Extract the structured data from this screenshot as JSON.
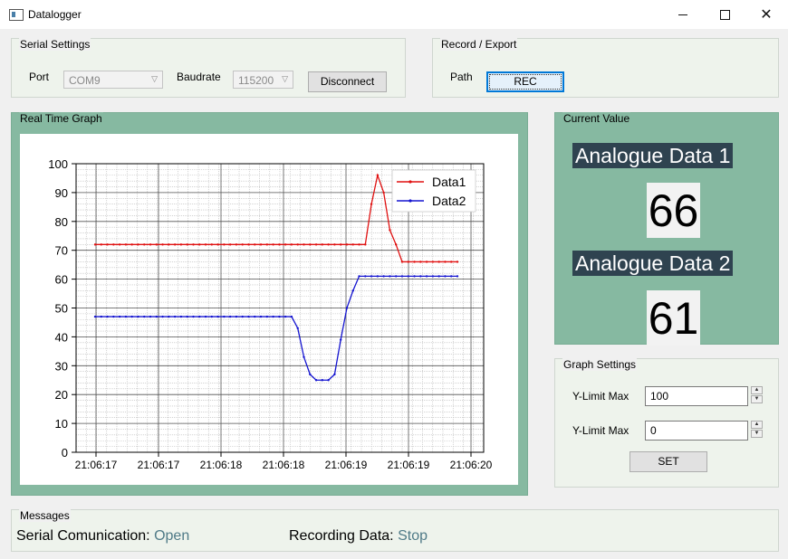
{
  "window": {
    "title": "Datalogger",
    "minimize_icon": "minimize-icon",
    "maximize_icon": "maximize-icon",
    "close_icon": "close-icon",
    "close_glyph": "✕"
  },
  "serial": {
    "group_label": "Serial Settings",
    "port_label": "Port",
    "port_value": "COM9",
    "baud_label": "Baudrate",
    "baud_value": "115200",
    "disconnect_label": "Disconnect",
    "chevron": "▽"
  },
  "record": {
    "group_label": "Record / Export",
    "path_label": "Path",
    "rec_label": "REC"
  },
  "graph": {
    "group_label": "Real Time Graph"
  },
  "current": {
    "group_label": "Current Value",
    "label1": "Analogue Data 1",
    "value1": "66",
    "label2": "Analogue Data 2",
    "value2": "61"
  },
  "graph_settings": {
    "group_label": "Graph Settings",
    "ymax_label": "Y-Limit Max",
    "ymax_value": "100",
    "ymin_label": "Y-Limit Max",
    "ymin_value": "0",
    "set_label": "SET",
    "up_glyph": "▲",
    "down_glyph": "▼"
  },
  "messages": {
    "group_label": "Messages",
    "serial_label": "Serial Comunication:",
    "serial_value": "Open",
    "recording_label": "Recording Data:",
    "recording_value": "Stop"
  },
  "chart_data": {
    "type": "line",
    "x": [
      0,
      1,
      2,
      3,
      4,
      5,
      6,
      7,
      8,
      9,
      10,
      11,
      12,
      13,
      14,
      15,
      16,
      17,
      18,
      19,
      20,
      21,
      22,
      23,
      24,
      25,
      26,
      27,
      28,
      29,
      30,
      31,
      32,
      33,
      34,
      35,
      36,
      37,
      38,
      39,
      40,
      41,
      42,
      43,
      44,
      45,
      46,
      47,
      48,
      49,
      50,
      51,
      52,
      53,
      54,
      55,
      56,
      57,
      58,
      59
    ],
    "xticklabels": [
      "21:06:17",
      "21:06:17",
      "21:06:18",
      "21:06:18",
      "21:06:19",
      "21:06:19",
      "21:06:20"
    ],
    "ylim": [
      0,
      100
    ],
    "yticks": [
      0,
      10,
      20,
      30,
      40,
      50,
      60,
      70,
      80,
      90,
      100
    ],
    "grid": true,
    "legend": "top-right",
    "series": [
      {
        "name": "Data1",
        "color": "#e01010",
        "values": [
          72,
          72,
          72,
          72,
          72,
          72,
          72,
          72,
          72,
          72,
          72,
          72,
          72,
          72,
          72,
          72,
          72,
          72,
          72,
          72,
          72,
          72,
          72,
          72,
          72,
          72,
          72,
          72,
          72,
          72,
          72,
          72,
          72,
          72,
          72,
          72,
          72,
          72,
          72,
          72,
          72,
          72,
          72,
          72,
          72,
          86,
          96,
          90,
          77,
          72,
          66,
          66,
          66,
          66,
          66,
          66,
          66,
          66,
          66,
          66
        ]
      },
      {
        "name": "Data2",
        "color": "#1515d0",
        "values": [
          47,
          47,
          47,
          47,
          47,
          47,
          47,
          47,
          47,
          47,
          47,
          47,
          47,
          47,
          47,
          47,
          47,
          47,
          47,
          47,
          47,
          47,
          47,
          47,
          47,
          47,
          47,
          47,
          47,
          47,
          47,
          47,
          47,
          43,
          33,
          27,
          25,
          25,
          25,
          27,
          39,
          50,
          56,
          61,
          61,
          61,
          61,
          61,
          61,
          61,
          61,
          61,
          61,
          61,
          61,
          61,
          61,
          61,
          61,
          61
        ]
      }
    ]
  }
}
